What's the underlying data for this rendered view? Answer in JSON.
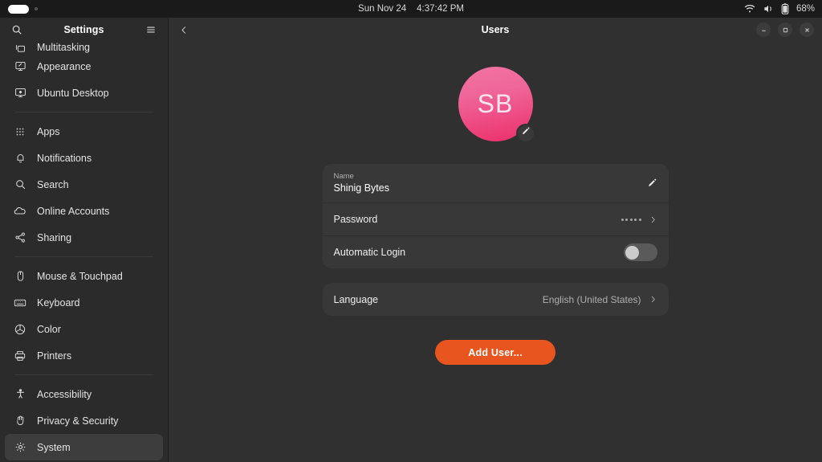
{
  "topbar": {
    "date_time": "Sun Nov 24",
    "clock": "4:37:42 PM",
    "battery_percent": "68%",
    "window_indicator_icon": "window-pill-icon",
    "dot_icon": "small-dot-icon",
    "wifi_icon": "wifi-icon",
    "volume_icon": "volume-icon",
    "battery_icon": "battery-icon"
  },
  "sidebar": {
    "title": "Settings",
    "search_icon": "search-icon",
    "menu_icon": "hamburger-menu-icon",
    "groups": [
      {
        "items": [
          {
            "label": "Multitasking",
            "icon": "multitasking-icon",
            "clipped": true
          },
          {
            "label": "Appearance",
            "icon": "appearance-icon",
            "clipped": false
          },
          {
            "label": "Ubuntu Desktop",
            "icon": "ubuntu-desktop-icon",
            "clipped": false
          }
        ]
      },
      {
        "items": [
          {
            "label": "Apps",
            "icon": "apps-grid-icon",
            "clipped": false
          },
          {
            "label": "Notifications",
            "icon": "bell-icon",
            "clipped": false
          },
          {
            "label": "Search",
            "icon": "search-icon",
            "clipped": false
          },
          {
            "label": "Online Accounts",
            "icon": "cloud-icon",
            "clipped": false
          },
          {
            "label": "Sharing",
            "icon": "share-nodes-icon",
            "clipped": false
          }
        ]
      },
      {
        "items": [
          {
            "label": "Mouse & Touchpad",
            "icon": "mouse-icon",
            "clipped": false
          },
          {
            "label": "Keyboard",
            "icon": "keyboard-icon",
            "clipped": false
          },
          {
            "label": "Color",
            "icon": "color-wheel-icon",
            "clipped": false
          },
          {
            "label": "Printers",
            "icon": "printer-icon",
            "clipped": false
          }
        ]
      },
      {
        "items": [
          {
            "label": "Accessibility",
            "icon": "accessibility-icon",
            "clipped": false
          },
          {
            "label": "Privacy & Security",
            "icon": "hand-shield-icon",
            "clipped": false
          },
          {
            "label": "System",
            "icon": "gear-icon",
            "clipped": false
          }
        ]
      }
    ],
    "active_item": "System"
  },
  "header": {
    "title": "Users",
    "back_icon": "chevron-left-icon",
    "minimize_label": "–",
    "maximize_label": "□",
    "close_label": "×",
    "minimize_icon": "minimize-icon",
    "maximize_icon": "maximize-icon",
    "close_icon": "close-icon"
  },
  "user": {
    "avatar_initials": "SB",
    "avatar_edit_icon": "pencil-icon",
    "avatar_color_top": "#f274a2",
    "avatar_color_bottom": "#ec2f6b"
  },
  "settings_card": {
    "name_row": {
      "sublabel": "Name",
      "value": "Shinig Bytes",
      "edit_icon": "pencil-icon"
    },
    "password_row": {
      "label": "Password",
      "masked_value": "•••••",
      "chevron_icon": "chevron-right-icon"
    },
    "automatic_login_row": {
      "label": "Automatic Login",
      "toggle_state": "off",
      "toggle_icon": "toggle-switch-icon"
    }
  },
  "language_card": {
    "label": "Language",
    "value": "English (United States)",
    "chevron_icon": "chevron-right-icon"
  },
  "actions": {
    "add_user_label": "Add User...",
    "accent_color": "#e9551f"
  }
}
